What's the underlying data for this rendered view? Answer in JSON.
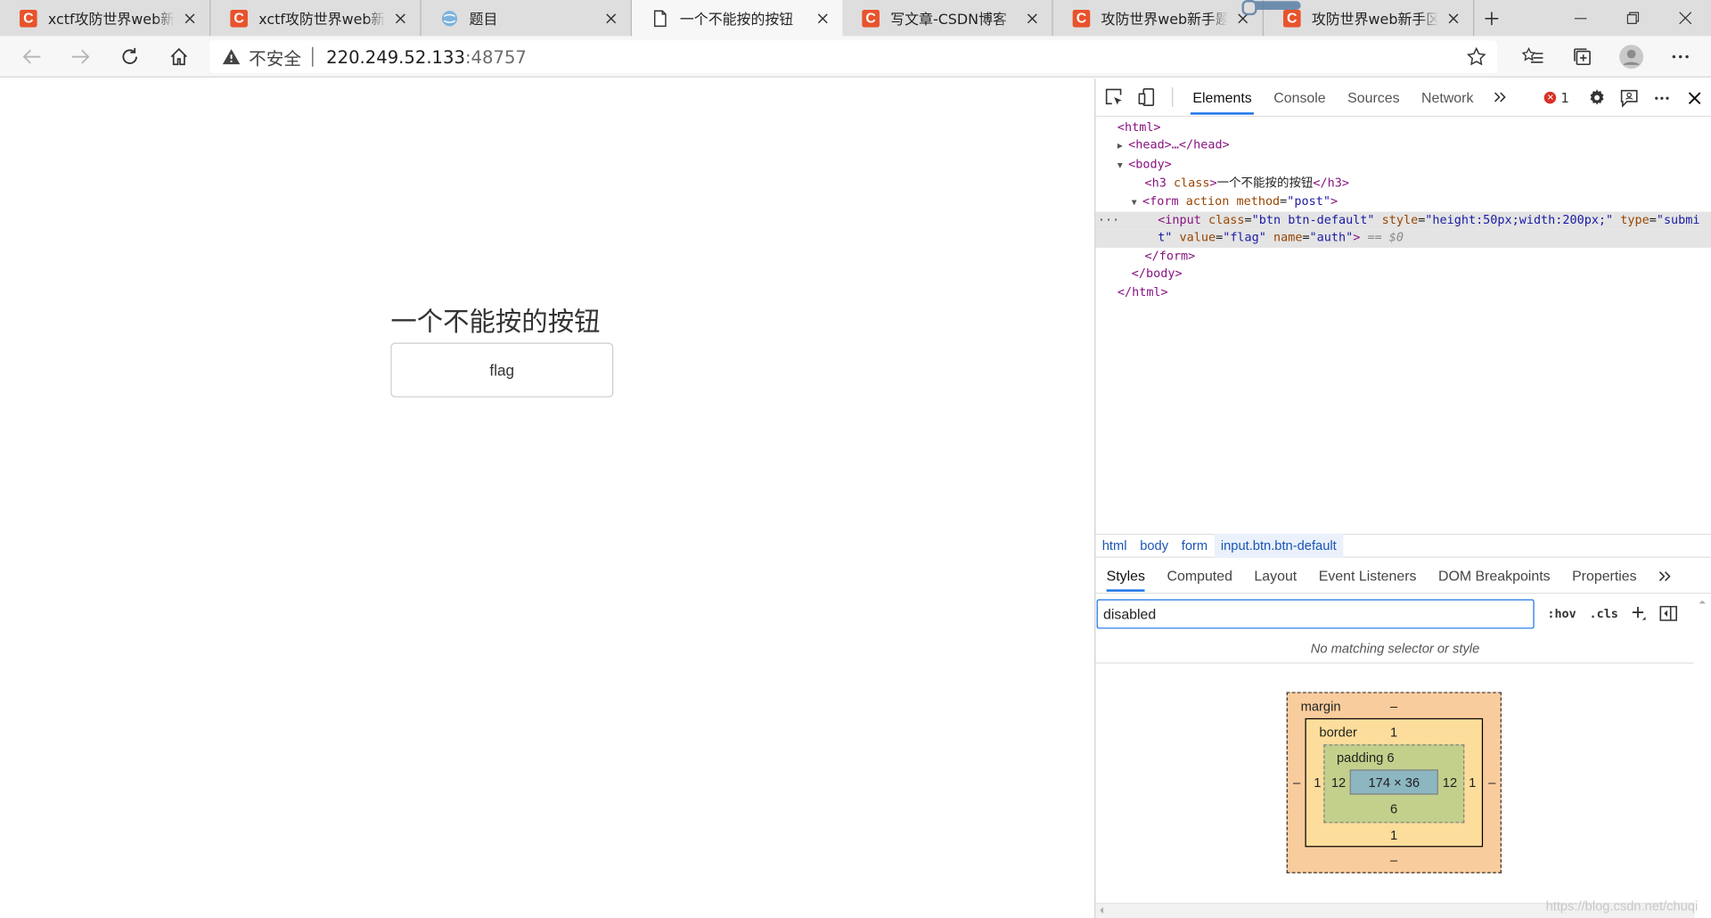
{
  "browser": {
    "tabs": [
      {
        "title": "xctf攻防世界web新手练",
        "favicon": "csdn-icon"
      },
      {
        "title": "xctf攻防世界web新手练",
        "favicon": "csdn-icon"
      },
      {
        "title": "题目",
        "favicon": "globe-icon"
      },
      {
        "title": "一个不能按的按钮",
        "favicon": "page-icon"
      },
      {
        "title": "写文章-CSDN博客",
        "favicon": "csdn-icon"
      },
      {
        "title": "攻防世界web新手题答",
        "favicon": "csdn-icon"
      },
      {
        "title": "攻防世界web新手区题",
        "favicon": "csdn-icon"
      }
    ],
    "address": {
      "security_label": "不安全",
      "host": "220.249.52.133",
      "port": ":48757"
    }
  },
  "page": {
    "heading": "一个不能按的按钮",
    "button_value": "flag"
  },
  "devtools": {
    "tabs": [
      "Elements",
      "Console",
      "Sources",
      "Network"
    ],
    "error_count": "1",
    "dom": {
      "html_open": "<html>",
      "head": "<head>…</head>",
      "body_open": "<body>",
      "h3_open": "<h3",
      "h3_attr": "class",
      "h3_text": "一个不能按的按钮",
      "h3_close": "</h3>",
      "form_open": "<form",
      "form_attr1": "action",
      "form_attr2": "method",
      "form_attr2_val": "\"post\"",
      "form_gt": ">",
      "input_open": "<input",
      "input_class": "class",
      "input_class_val": "\"btn btn-default\"",
      "input_style": "style",
      "input_style_val": "\"height:50px;width:200px;\"",
      "input_type": "type",
      "input_type_val1": "\"submi",
      "input_type_val2": "t\"",
      "input_value": "value",
      "input_value_val": "\"flag\"",
      "input_name": "name",
      "input_name_val": "\"auth\"",
      "input_gt": ">",
      "eq0": "== $0",
      "form_close": "</form>",
      "body_close": "</body>",
      "html_close": "</html>"
    },
    "breadcrumbs": [
      "html",
      "body",
      "form",
      "input.btn.btn-default"
    ],
    "subtabs": [
      "Styles",
      "Computed",
      "Layout",
      "Event Listeners",
      "DOM Breakpoints",
      "Properties"
    ],
    "filter_value": "disabled",
    "hov": ":hov",
    "cls": ".cls",
    "no_match": "No matching selector or style",
    "box_model": {
      "margin_label": "margin",
      "margin_top": "–",
      "margin_left": "–",
      "margin_right": "–",
      "margin_bottom": "–",
      "border_label": "border",
      "border_top": "1",
      "border_left": "1",
      "border_right": "1",
      "border_bottom": "1",
      "padding_label": "padding 6",
      "padding_left": "12",
      "padding_right": "12",
      "padding_bottom": "6",
      "content": "174 × 36"
    }
  },
  "watermark": "https://blog.csdn.net/chuqi"
}
